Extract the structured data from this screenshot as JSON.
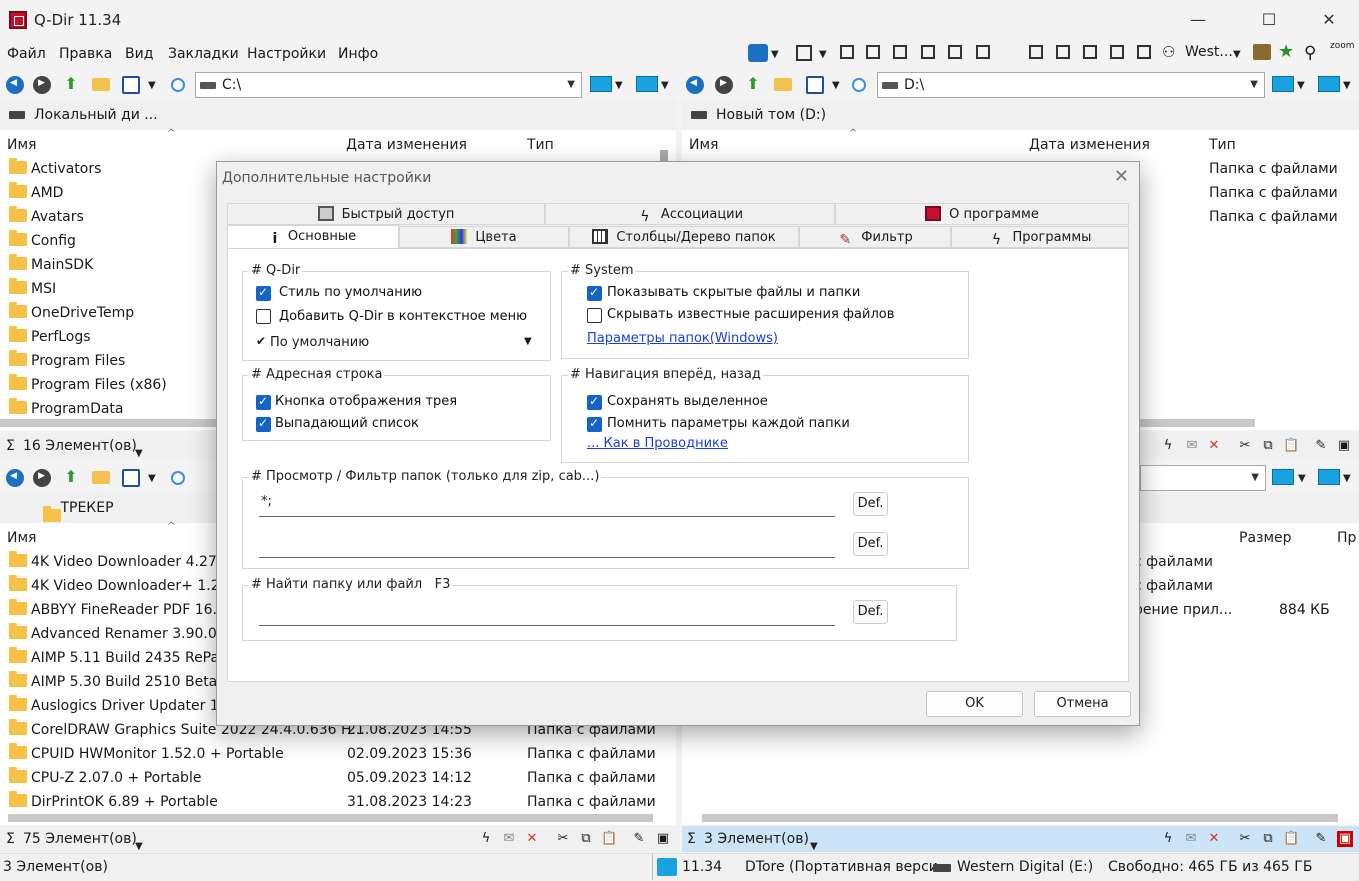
{
  "window": {
    "title": "Q-Dir 11.34"
  },
  "menu": [
    "Файл",
    "Правка",
    "Вид",
    "Закладки",
    "Настройки",
    "Инфо"
  ],
  "toolbar_right": {
    "drive_label": "West..."
  },
  "pane_tl": {
    "address": "C:\\",
    "tab": "Локальный ди ...",
    "cols": [
      "Имя",
      "Дата изменения",
      "Тип"
    ],
    "rows": [
      "Activators",
      "AMD",
      "Avatars",
      "Config",
      "MainSDK",
      "MSI",
      "OneDriveTemp",
      "PerfLogs",
      "Program Files",
      "Program Files (x86)",
      "ProgramData"
    ],
    "status": "16 Элемент(ов)"
  },
  "pane_tr": {
    "address": "D:\\",
    "tab": "Новый том (D:)",
    "cols": [
      "Имя",
      "Дата изменения",
      "Тип"
    ],
    "rows": [
      "Папка с файлами",
      "Папка с файлами",
      "Папка с файлами"
    ]
  },
  "pane_bl": {
    "tab": "ТРЕКЕР",
    "cols": [
      "Имя"
    ],
    "rows": [
      {
        "name": "4K Video Downloader 4.27.0",
        "date": "",
        "type": ""
      },
      {
        "name": "4K Video Downloader+ 1.2.3",
        "date": "",
        "type": ""
      },
      {
        "name": "ABBYY FineReader PDF 16.0",
        "date": "",
        "type": ""
      },
      {
        "name": "Advanced Renamer 3.90.0 R",
        "date": "",
        "type": ""
      },
      {
        "name": "AIMP 5.11 Build 2435 RePac",
        "date": "",
        "type": ""
      },
      {
        "name": "AIMP 5.30 Build 2510 Beta +",
        "date": "",
        "type": ""
      },
      {
        "name": "Auslogics Driver Updater 1.2",
        "date": "",
        "type": ""
      },
      {
        "name": "CorelDRAW Graphics Suite 2022 24.4.0.636 H...",
        "date": "21.08.2023 14:55",
        "type": "Папка с файлами"
      },
      {
        "name": "CPUID HWMonitor 1.52.0 + Portable",
        "date": "02.09.2023 15:36",
        "type": "Папка с файлами"
      },
      {
        "name": "CPU-Z 2.07.0 + Portable",
        "date": "05.09.2023 14:12",
        "type": "Папка с файлами"
      },
      {
        "name": "DirPrintOK 6.89 + Portable",
        "date": "31.08.2023 14:23",
        "type": "Папка с файлами"
      }
    ],
    "status": "75 Элемент(ов)"
  },
  "pane_br": {
    "cols": [
      "Размер",
      "Пр"
    ],
    "rows": [
      {
        "type": "с файлами",
        "size": ""
      },
      {
        "type": "с файлами",
        "size": ""
      },
      {
        "type": "рение прил...",
        "size": "884 КБ"
      }
    ],
    "status": "3 Элемент(ов)"
  },
  "bottom": {
    "left": "3 Элемент(ов)",
    "version": "11.34",
    "app": "DTore (Портативная верси",
    "drive": "Western Digital (E:)",
    "free": "Свободно: 465 ГБ из 465 ГБ"
  },
  "dialog": {
    "title": "Дополнительные настройки",
    "tabs_row1": [
      "Быстрый доступ",
      "Ассоциации",
      "О программе"
    ],
    "tabs_row2": [
      "Основные",
      "Цвета",
      "Столбцы/Дерево папок",
      "Фильтр",
      "Программы"
    ],
    "qdir": {
      "label": "# Q-Dir",
      "opt1": "Стиль по умолчанию",
      "opt2": "Добавить Q-Dir в контекстное меню",
      "dropdown": "По умолчанию"
    },
    "system": {
      "label": "# System",
      "opt1": "Показывать скрытые файлы и папки",
      "opt2": "Скрывать известные расширения файлов",
      "link": "Параметры папок(Windows)"
    },
    "address": {
      "label": "# Адресная строка",
      "opt1": "Кнопка отображения трея",
      "opt2": "Выпадающий список"
    },
    "nav": {
      "label": "# Навигация вперёд, назад",
      "opt1": "Сохранять выделенное",
      "opt2": "Помнить параметры каждой папки",
      "link": "... Как в Проводнике"
    },
    "filter": {
      "label": "# Просмотр / Фильтр папок (только для zip, cab...)",
      "value1": "*;",
      "value2": "",
      "def": "Def."
    },
    "find": {
      "label": "# Найти папку или файл",
      "hotkey": "F3",
      "value": "",
      "def": "Def."
    },
    "ok": "OK",
    "cancel": "Отмена"
  }
}
